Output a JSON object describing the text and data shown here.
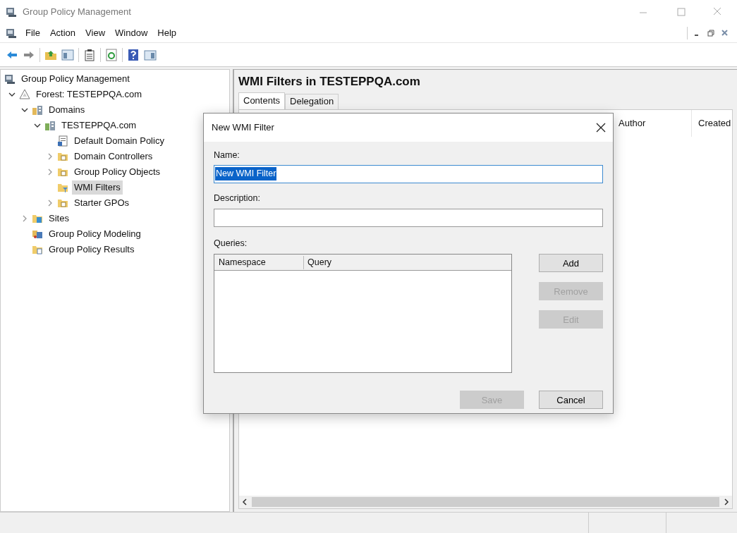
{
  "window": {
    "title": "Group Policy Management"
  },
  "menu": [
    "File",
    "Action",
    "View",
    "Window",
    "Help"
  ],
  "tree": [
    {
      "label": "Group Policy Management",
      "kind": "console",
      "selected": false,
      "children": [
        {
          "label": "Forest: TESTEPPQA.com",
          "kind": "forest",
          "expanded": true,
          "selected": false,
          "children": [
            {
              "label": "Domains",
              "kind": "domains",
              "expanded": true,
              "selected": false,
              "children": [
                {
                  "label": "TESTEPPQA.com",
                  "kind": "domain",
                  "expanded": true,
                  "selected": false,
                  "children": [
                    {
                      "label": "Default Domain Policy",
                      "kind": "policy",
                      "selected": false
                    },
                    {
                      "label": "Domain Controllers",
                      "kind": "folder",
                      "expanded": false,
                      "selected": false
                    },
                    {
                      "label": "Group Policy Objects",
                      "kind": "folder",
                      "expanded": false,
                      "selected": false
                    },
                    {
                      "label": "WMI Filters",
                      "kind": "filter",
                      "selected": true
                    },
                    {
                      "label": "Starter GPOs",
                      "kind": "folder",
                      "expanded": false,
                      "selected": false
                    }
                  ]
                }
              ]
            },
            {
              "label": "Sites",
              "kind": "sites",
              "expanded": false,
              "selected": false
            },
            {
              "label": "Group Policy Modeling",
              "kind": "modeling",
              "selected": false
            },
            {
              "label": "Group Policy Results",
              "kind": "results",
              "selected": false
            }
          ]
        }
      ]
    }
  ],
  "panel": {
    "title": "WMI Filters in TESTEPPQA.com",
    "tabs": [
      {
        "label": "Contents",
        "selected": true
      },
      {
        "label": "Delegation",
        "selected": false
      }
    ],
    "columns": [
      "Author",
      "Created"
    ]
  },
  "dialog": {
    "title": "New WMI Filter",
    "name_label": "Name:",
    "name_value": "New WMI Filter",
    "description_label": "Description:",
    "queries_label": "Queries:",
    "query_columns": [
      "Namespace",
      "Query"
    ],
    "side_buttons": [
      {
        "label": "Add",
        "disabled": false
      },
      {
        "label": "Remove",
        "disabled": true
      },
      {
        "label": "Edit",
        "disabled": true
      }
    ],
    "footer_buttons": [
      {
        "label": "Save",
        "disabled": true
      },
      {
        "label": "Cancel",
        "disabled": false
      }
    ]
  }
}
